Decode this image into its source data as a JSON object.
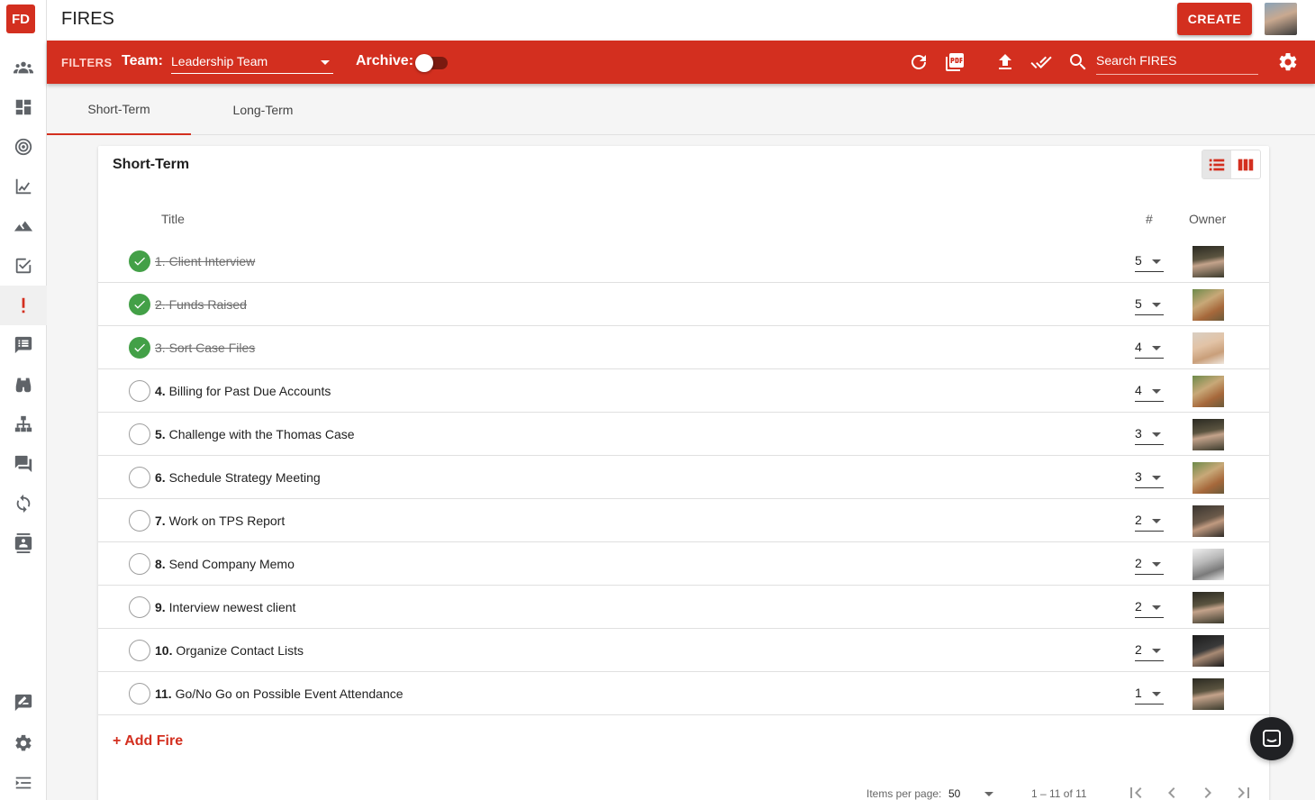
{
  "app": {
    "logo": "FD",
    "page_title": "FIRES",
    "create_label": "CREATE"
  },
  "sidebar": {
    "items": [
      {
        "name": "people-icon"
      },
      {
        "name": "dashboard-icon"
      },
      {
        "name": "target-icon"
      },
      {
        "name": "chart-icon"
      },
      {
        "name": "mountain-icon"
      },
      {
        "name": "checkbox-icon"
      },
      {
        "name": "exclamation-icon",
        "active": true
      },
      {
        "name": "notes-icon"
      },
      {
        "name": "binoculars-icon"
      },
      {
        "name": "org-chart-icon"
      },
      {
        "name": "forum-icon"
      },
      {
        "name": "sync-icon"
      },
      {
        "name": "contacts-icon"
      },
      {
        "name": "feedback-icon"
      },
      {
        "name": "gear-icon"
      },
      {
        "name": "menu-expand-icon"
      }
    ],
    "accent": "#d32f1f"
  },
  "filterbar": {
    "filters_label": "FILTERS",
    "team_label": "Team:",
    "team_value": "Leadership Team",
    "archive_label": "Archive:",
    "search_placeholder": "Search FIRES"
  },
  "tabs": [
    {
      "label": "Short-Term",
      "active": true
    },
    {
      "label": "Long-Term",
      "active": false
    }
  ],
  "card": {
    "title": "Short-Term",
    "columns": {
      "title": "Title",
      "rank": "#",
      "owner": "Owner"
    },
    "rows": [
      {
        "num": "1.",
        "title": "Client Interview",
        "rank": "5",
        "done": true,
        "avatar": "av-a"
      },
      {
        "num": "2.",
        "title": "Funds Raised",
        "rank": "5",
        "done": true,
        "avatar": "av-b"
      },
      {
        "num": "3.",
        "title": "Sort Case Files",
        "rank": "4",
        "done": true,
        "avatar": "av-c"
      },
      {
        "num": "4.",
        "title": "Billing for Past Due Accounts",
        "rank": "4",
        "done": false,
        "avatar": "av-b"
      },
      {
        "num": "5.",
        "title": "Challenge with the Thomas Case",
        "rank": "3",
        "done": false,
        "avatar": "av-a"
      },
      {
        "num": "6.",
        "title": "Schedule Strategy Meeting",
        "rank": "3",
        "done": false,
        "avatar": "av-b"
      },
      {
        "num": "7.",
        "title": "Work on TPS Report",
        "rank": "2",
        "done": false,
        "avatar": "av-d"
      },
      {
        "num": "8.",
        "title": "Send Company Memo",
        "rank": "2",
        "done": false,
        "avatar": "av-e"
      },
      {
        "num": "9.",
        "title": "Interview newest client",
        "rank": "2",
        "done": false,
        "avatar": "av-a"
      },
      {
        "num": "10.",
        "title": "Organize Contact Lists",
        "rank": "2",
        "done": false,
        "avatar": "av-f"
      },
      {
        "num": "11.",
        "title": "Go/No Go on Possible Event Attendance",
        "rank": "1",
        "done": false,
        "avatar": "av-a"
      }
    ],
    "add_label": "+ Add Fire"
  },
  "paginator": {
    "items_label": "Items per page:",
    "page_size": "50",
    "range": "1 – 11 of 11"
  }
}
